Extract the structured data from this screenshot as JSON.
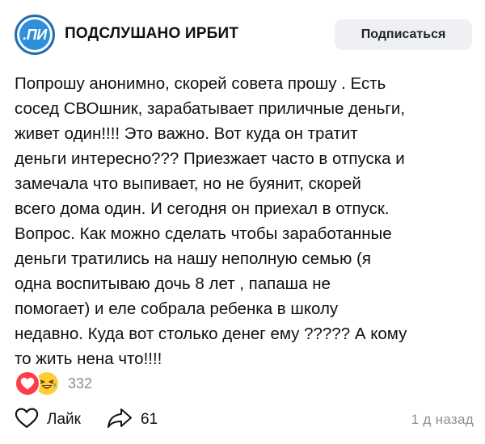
{
  "header": {
    "avatar_text": ".ПИ",
    "channel_name": "ПОДСЛУШАНО ИРБИТ",
    "subscribe_label": "Подписаться"
  },
  "post": {
    "lines": [
      "Попрошу анонимно, скорей совета прошу . Есть",
      "сосед СВОшник, зарабатывает приличные деньги,",
      "живет один!!!! Это важно. Вот куда он тратит",
      "деньги интересно??? Приезжает часто в отпуска и",
      "замечала что выпивает, но не буянит, скорей",
      "всего дома один. И сегодня он приехал в отпуск.",
      "Вопрос. Как можно сделать чтобы заработанные",
      "деньги тратились на нашу неполную семью (я",
      "одна воспитываю дочь 8 лет , папаша не",
      "помогает) и еле собрала ребенка в школу",
      "недавно. Куда вот столько денег ему ????? А кому",
      "то жить нена что!!!!"
    ]
  },
  "reactions": {
    "icons": [
      "heart-icon",
      "laughing-emoji-icon"
    ],
    "count": "332"
  },
  "footer": {
    "like_label": "Лайк",
    "share_count": "61",
    "timestamp": "1 д назад"
  },
  "colors": {
    "avatar": "#2f8fd8",
    "heart": "#ff3b4a",
    "muted_text": "#8a8f96",
    "button_bg": "#eef0f3"
  }
}
